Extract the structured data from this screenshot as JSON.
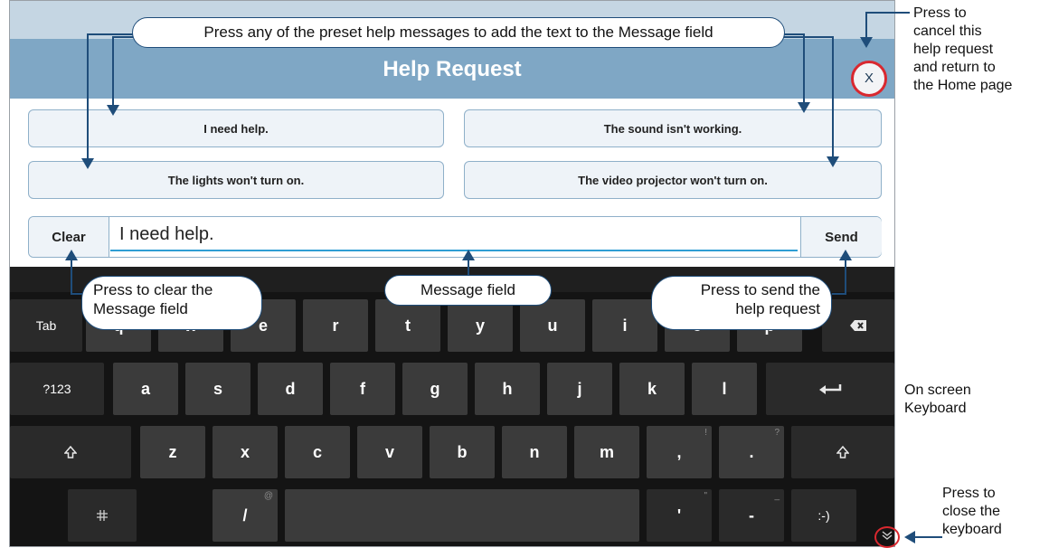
{
  "header": {
    "title": "Help Request",
    "close_label": "X"
  },
  "presets": [
    "I need help.",
    "The sound isn't working.",
    "The lights won't turn on.",
    "The video projector won't turn on."
  ],
  "message": {
    "clear_label": "Clear",
    "value": "I need help.",
    "send_label": "Send"
  },
  "keyboard": {
    "row1": {
      "tab": "Tab",
      "keys": [
        "q",
        "w",
        "e",
        "r",
        "t",
        "y",
        "u",
        "i",
        "o",
        "p"
      ],
      "backspace_icon": "backspace-icon"
    },
    "row2": {
      "mode": "?123",
      "keys": [
        "a",
        "s",
        "d",
        "f",
        "g",
        "h",
        "j",
        "k",
        "l"
      ],
      "enter_icon": "enter-arrow-icon"
    },
    "row3": {
      "shift_icon": "shift-icon",
      "keys": [
        "z",
        "x",
        "c",
        "v",
        "b",
        "n",
        "m",
        ",",
        "."
      ],
      "hints": {
        "comma": "!",
        "period": "?"
      }
    },
    "row4": {
      "settings_icon": "keyboard-settings-icon",
      "slash": "/",
      "slash_hint": "@",
      "apostrophe": "'",
      "apostrophe_hint": "\"",
      "dash": "-",
      "dash_hint": "_",
      "smiley": ":-)",
      "hide_icon": "chevron-down-icon"
    }
  },
  "callouts": {
    "presets": "Press any of the preset help messages to add the text to the Message field",
    "clear_l1": "Press to clear the",
    "clear_l2": "Message field",
    "message_field": "Message field",
    "send_l1": "Press to send the",
    "send_l2": "help request"
  },
  "side_notes": {
    "cancel": [
      "Press to",
      "cancel this",
      "help request",
      "and return to",
      "the Home page"
    ],
    "keyboard": [
      "On screen",
      "Keyboard"
    ],
    "close_kb": [
      "Press to",
      "close the",
      "keyboard"
    ]
  },
  "colors": {
    "header": "#7fa7c5",
    "top_strip": "#c5d6e3",
    "accent": "#1f4d7a",
    "highlight_red": "#d9282f"
  }
}
